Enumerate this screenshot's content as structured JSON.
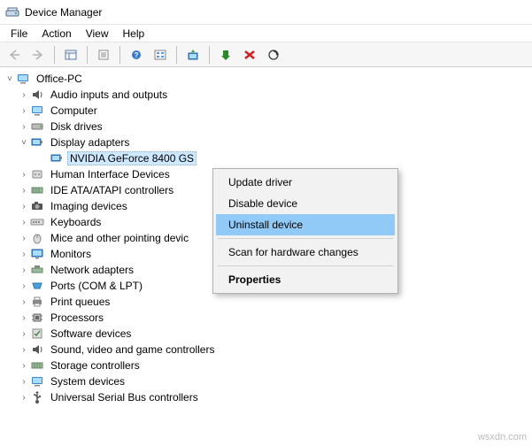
{
  "window": {
    "title": "Device Manager"
  },
  "menubar": {
    "file": "File",
    "action": "Action",
    "view": "View",
    "help": "Help"
  },
  "tree": {
    "root": "Office-PC",
    "items": [
      {
        "label": "Audio inputs and outputs",
        "expanded": false
      },
      {
        "label": "Computer",
        "expanded": false
      },
      {
        "label": "Disk drives",
        "expanded": false
      },
      {
        "label": "Display adapters",
        "expanded": true,
        "children": [
          {
            "label": "NVIDIA GeForce 8400 GS"
          }
        ]
      },
      {
        "label": "Human Interface Devices",
        "expanded": false
      },
      {
        "label": "IDE ATA/ATAPI controllers",
        "expanded": false
      },
      {
        "label": "Imaging devices",
        "expanded": false
      },
      {
        "label": "Keyboards",
        "expanded": false
      },
      {
        "label": "Mice and other pointing devic",
        "expanded": false
      },
      {
        "label": "Monitors",
        "expanded": false
      },
      {
        "label": "Network adapters",
        "expanded": false
      },
      {
        "label": "Ports (COM & LPT)",
        "expanded": false
      },
      {
        "label": "Print queues",
        "expanded": false
      },
      {
        "label": "Processors",
        "expanded": false
      },
      {
        "label": "Software devices",
        "expanded": false
      },
      {
        "label": "Sound, video and game controllers",
        "expanded": false
      },
      {
        "label": "Storage controllers",
        "expanded": false
      },
      {
        "label": "System devices",
        "expanded": false
      },
      {
        "label": "Universal Serial Bus controllers",
        "expanded": false
      }
    ]
  },
  "context_menu": {
    "update": "Update driver",
    "disable": "Disable device",
    "uninstall": "Uninstall device",
    "scan": "Scan for hardware changes",
    "properties": "Properties"
  },
  "watermark": "wsxdn.com"
}
